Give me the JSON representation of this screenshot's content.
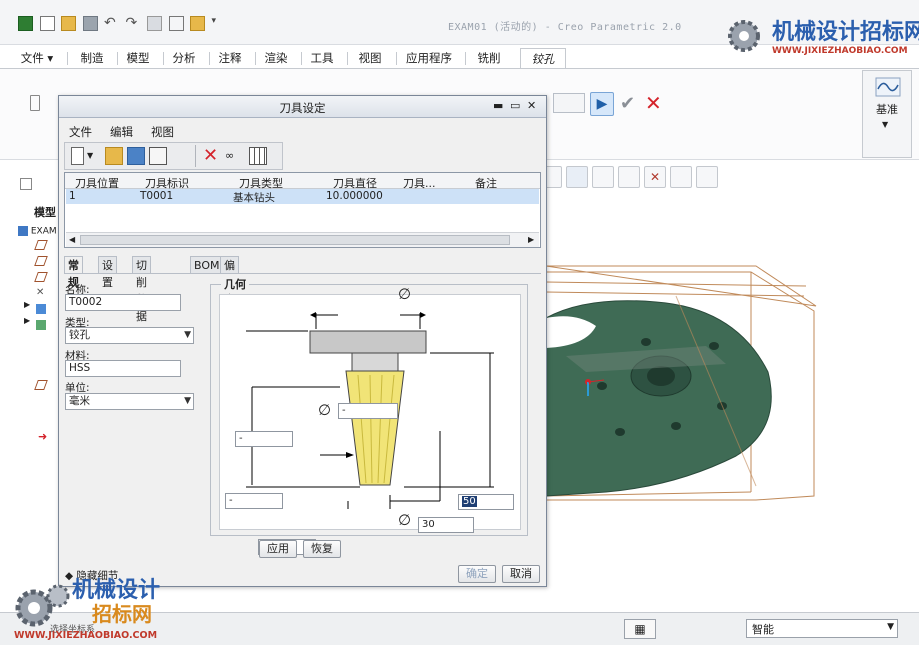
{
  "app": {
    "title": "EXAM01 (活动的) - Creo Parametric 2.0",
    "ribbon_tabs": [
      "文件",
      "制造",
      "模型",
      "分析",
      "注释",
      "渲染",
      "工具",
      "视图",
      "应用程序",
      "铣削",
      "铰孔"
    ],
    "active_tab": "铰孔",
    "ref_panel_label": "基准",
    "model_tree_title": "模型",
    "model_tree_root": "EXAM",
    "status_filter": "智能",
    "hide_detail_label": "隐藏细节",
    "status_link": "选择坐标系",
    "colors": {
      "accent_blue": "#2b78c6",
      "cancel_red": "#d4232b",
      "confirm_gray": "#8a8f96",
      "part_green": "#3f6b55"
    }
  },
  "dialog": {
    "title": "刀具设定",
    "menu": [
      "文件",
      "编辑",
      "视图"
    ],
    "toolbar_icons": [
      "new-tool-icon",
      "open-icon",
      "save-icon",
      "tool-library-icon",
      "delete-icon",
      "preview-icon",
      "table-columns-icon"
    ],
    "table": {
      "columns": [
        "刀具位置",
        "刀具标识",
        "刀具类型",
        "刀具直径",
        "刀具...",
        "备注"
      ],
      "rows": [
        {
          "pos": "1",
          "id": "T0001",
          "type": "基本钻头",
          "diameter": "10.000000",
          "extra": "",
          "note": ""
        }
      ]
    },
    "subtabs": [
      "常规",
      "设置",
      "切削数据",
      "BOM",
      "偏移表"
    ],
    "active_subtab": "常规",
    "form": {
      "name_label": "名称:",
      "name_value": "T0002",
      "type_label": "类型:",
      "type_value": "铰孔",
      "material_label": "材料:",
      "material_value": "HSS",
      "unit_label": "单位:",
      "unit_value": "毫米"
    },
    "geometry": {
      "label": "几何",
      "diameter_symbol": "∅",
      "top_diameter": "-",
      "shank_length": "-",
      "flute_length": "-",
      "tip_length": "-",
      "overall_length": "50",
      "cutting_diameter": "30"
    },
    "buttons": {
      "apply": "应用",
      "restore": "恢复",
      "ok": "确定",
      "cancel": "取消"
    }
  },
  "watermark": {
    "top_cn": "机械设计招标网",
    "top_url": "WWW.JIXIEZHAOBIAO.COM",
    "bottom_cn_1": "机械设计",
    "bottom_cn_2": "招标网",
    "bottom_url": "WWW.JIXIEZHAOBIAO.COM"
  }
}
